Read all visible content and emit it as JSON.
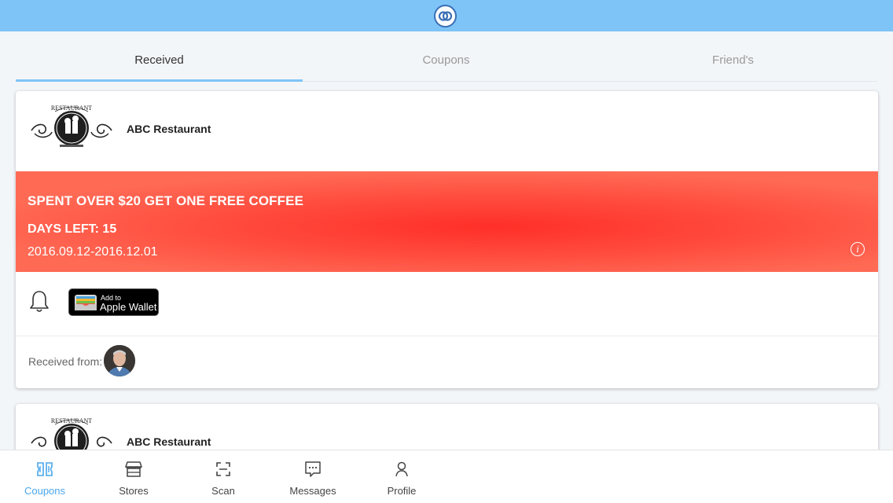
{
  "header": {
    "logo_icon": "linked-rings-icon"
  },
  "tabs": [
    {
      "label": "Received",
      "active": true
    },
    {
      "label": "Coupons",
      "active": false
    },
    {
      "label": "Friend's",
      "active": false
    }
  ],
  "coupons": [
    {
      "store_name": "ABC Restaurant",
      "store_logo_text": "RESTAURANT",
      "title": "SPENT OVER $20 GET ONE FREE COFFEE",
      "days_left": "DAYS LEFT: 15",
      "date_range": "2016.09.12-2016.12.01",
      "wallet_small": "Add to",
      "wallet_big": "Apple Wallet",
      "received_from_label": "Received from:"
    },
    {
      "store_name": "ABC Restaurant",
      "store_logo_text": "RESTAURANT"
    }
  ],
  "bottom_nav": [
    {
      "label": "Coupons",
      "icon": "coupons-icon",
      "active": true
    },
    {
      "label": "Stores",
      "icon": "store-icon",
      "active": false
    },
    {
      "label": "Scan",
      "icon": "scan-icon",
      "active": false
    },
    {
      "label": "Messages",
      "icon": "messages-icon",
      "active": false
    },
    {
      "label": "Profile",
      "icon": "profile-icon",
      "active": false
    }
  ],
  "colors": {
    "accent": "#7fc4f7",
    "banner": "#ff3b30",
    "active_nav": "#4aa6ec"
  }
}
